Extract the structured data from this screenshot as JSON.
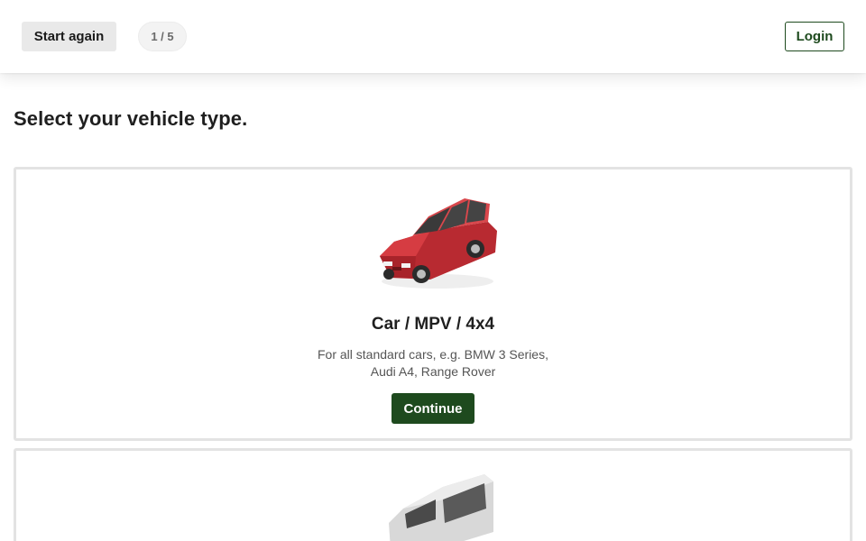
{
  "header": {
    "start_again_label": "Start again",
    "step_indicator": "1 / 5",
    "login_label": "Login"
  },
  "page": {
    "title": "Select your vehicle type."
  },
  "vehicles": [
    {
      "title": "Car / MPV / 4x4",
      "description": "For all standard cars, e.g. BMW 3 Series, Audi A4, Range Rover",
      "continue_label": "Continue",
      "image": "red-estate-car",
      "color": "#c8343a"
    },
    {
      "image": "white-van",
      "color": "#dcdcdc"
    }
  ],
  "colors": {
    "brand_green": "#1e4a1e",
    "card_border": "#e3e3e3",
    "neutral_button": "#e9e9e9"
  }
}
